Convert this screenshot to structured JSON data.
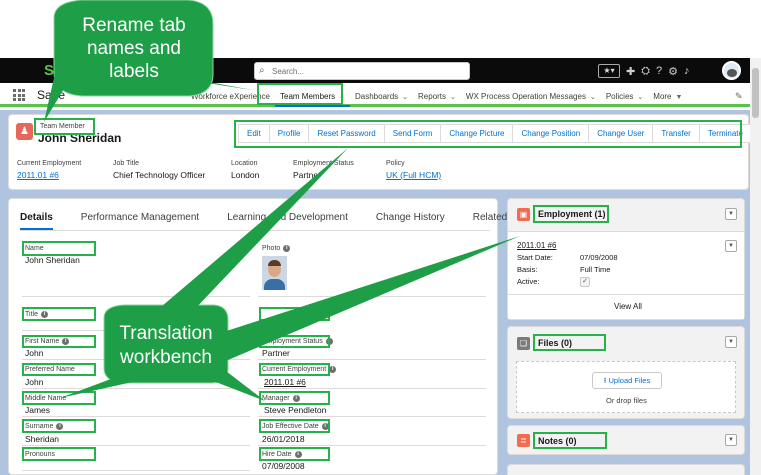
{
  "callouts": {
    "top_line1": "Rename tab",
    "top_line2": "names and",
    "top_line3": "labels",
    "middle_line1": "Translation",
    "middle_line2": "workbench"
  },
  "header": {
    "logo": "S",
    "search_placeholder": "Search...",
    "favorites_label": "★▾",
    "app_name": "Sage",
    "edit_icon": "pencil-icon"
  },
  "nav": {
    "items": [
      {
        "label": "Workforce eXperience",
        "chevron": ""
      },
      {
        "label": "Team Members",
        "chevron": "⌄"
      },
      {
        "label": "Dashboards",
        "chevron": "⌄"
      },
      {
        "label": "Reports",
        "chevron": "⌄"
      },
      {
        "label": "WX Process Operation Messages",
        "chevron": "⌄"
      },
      {
        "label": "Policies",
        "chevron": "⌄"
      },
      {
        "label": "More",
        "chevron": "▼"
      }
    ]
  },
  "record": {
    "type": "Team Member",
    "name": "John Sheridan",
    "actions": [
      "Edit",
      "Profile",
      "Reset Password",
      "Send Form",
      "Change Picture",
      "Change Position",
      "Change User",
      "Transfer",
      "Terminate"
    ],
    "menu": "▾",
    "fields": [
      {
        "label": "Current Employment",
        "value": "2011.01 #6"
      },
      {
        "label": "Job Title",
        "value": "Chief Technology Officer"
      },
      {
        "label": "Location",
        "value": "London"
      },
      {
        "label": "Employment Status",
        "value": "Partner"
      },
      {
        "label": "Policy",
        "value": "UK (Full HCM)"
      }
    ]
  },
  "tabs": [
    "Details",
    "Performance Management",
    "Learning And Development",
    "Change History",
    "Related"
  ],
  "details": {
    "name_label": "Name",
    "name_value": "John Sheridan",
    "photo_label": "Photo",
    "title_label": "Title",
    "first_name_label": "First Name",
    "first_name_value": "John",
    "employment_status_label": "Employment Status",
    "employment_status_value": "Partner",
    "preferred_name_label": "Preferred Name",
    "preferred_name_value": "John",
    "current_employment_label": "Current Employment",
    "current_employment_value": "2011.01 #6",
    "middle_name_label": "Middle Name",
    "middle_name_value": "James",
    "manager_label": "Manager",
    "manager_value": "Steve Pendleton",
    "surname_label": "Surname",
    "surname_value": "Sheridan",
    "job_effective_label": "Job Effective Date",
    "job_effective_value": "26/01/2018",
    "pronouns_label": "Pronouns",
    "hire_date_label": "Hire Date",
    "hire_date_value": "07/09/2008"
  },
  "employment_card": {
    "title": "Employment (1)",
    "record_link": "2011.01 #6",
    "start_label": "Start Date:",
    "start_value": "07/09/2008",
    "basis_label": "Basis:",
    "basis_value": "Full Time",
    "active_label": "Active:",
    "view_all": "View All"
  },
  "files_card": {
    "title": "Files (0)",
    "upload": "Upload Files",
    "drop": "Or drop files"
  },
  "notes_card": {
    "title": "Notes (0)"
  },
  "colors": {
    "accent_green": "#27b14b",
    "callout_green": "#1e9e46",
    "brand_green": "#59c24b",
    "link_blue": "#0070d2"
  }
}
